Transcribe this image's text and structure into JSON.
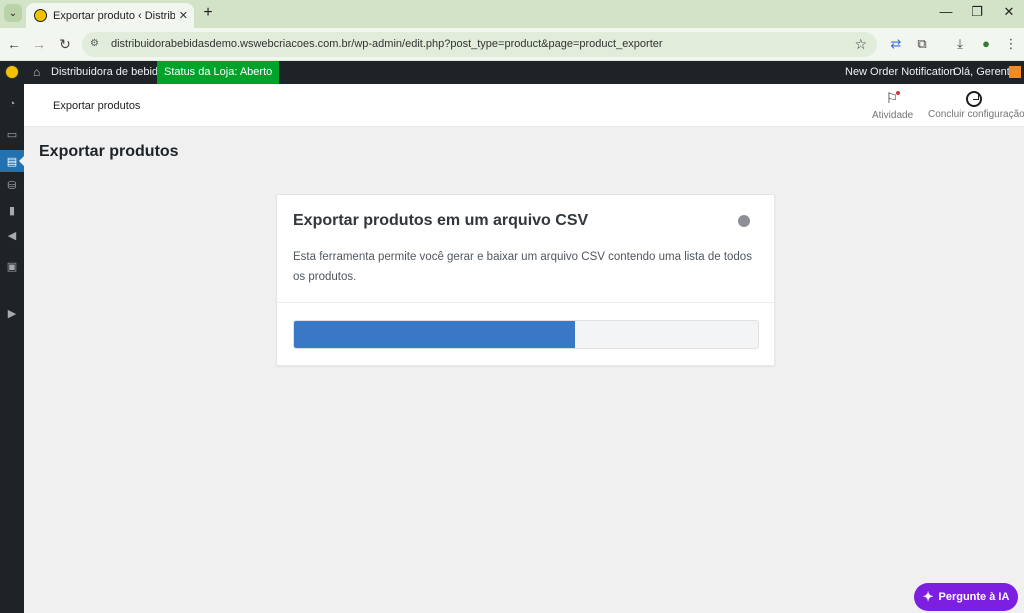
{
  "browser": {
    "tab_title": "Exportar produto ‹ Distribuidora",
    "url": "distribuidorabebidasdemo.wswebcriacoes.com.br/wp-admin/edit.php?post_type=product&page=product_exporter",
    "new_tab_glyph": "+",
    "close_glyph": "✕",
    "window": {
      "minimize": "—",
      "restore": "❐",
      "close": "✕"
    }
  },
  "adminbar": {
    "site_name": "Distribuidora de bebidas",
    "store_status": "Status da Loja: Aberto",
    "order_notification": "New Order Notification",
    "greeting": "Olá, Gerente",
    "store_status_color": "#00a32a"
  },
  "header": {
    "title": "Exportar produtos",
    "activity_label": "Atividade",
    "setup_label": "Concluir configuração"
  },
  "page": {
    "title": "Exportar produtos"
  },
  "card": {
    "title": "Exportar produtos em um arquivo CSV",
    "description": "Esta ferramenta permite você gerar e baixar um arquivo CSV contendo uma lista de todos os produtos.",
    "progress_fraction": 0.605,
    "progress_color": "#3878c7"
  },
  "ai_button": {
    "label": "Pergunte à IA",
    "color": "#7c1fe0"
  },
  "sidebar": {
    "items": [
      {
        "icon": "dashboard-icon",
        "glyph": "◔"
      },
      {
        "icon": "woocommerce-icon",
        "glyph": "▭"
      },
      {
        "icon": "products-icon",
        "glyph": "▤"
      },
      {
        "icon": "payments-icon",
        "glyph": "⛁"
      },
      {
        "icon": "analytics-icon",
        "glyph": "▮"
      },
      {
        "icon": "marketing-icon",
        "glyph": "◀"
      },
      {
        "icon": "appearance-icon",
        "glyph": "▣"
      },
      {
        "icon": "collapse-icon",
        "glyph": "▶"
      }
    ]
  }
}
